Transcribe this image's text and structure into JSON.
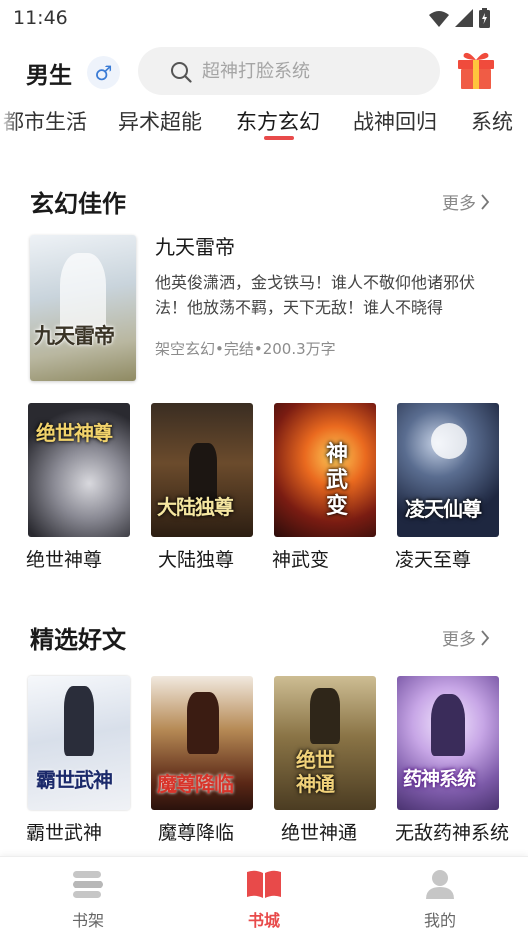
{
  "status_bar": {
    "time": "11:46"
  },
  "header": {
    "gender_label": "男生",
    "gender_symbol": "♂",
    "search_placeholder": "超神打脸系统"
  },
  "tabs": [
    {
      "label": "都市生活"
    },
    {
      "label": "异术超能"
    },
    {
      "label": "东方玄幻",
      "active": true
    },
    {
      "label": "战神回归"
    },
    {
      "label": "系统"
    }
  ],
  "sections": [
    {
      "title": "玄幻佳作",
      "more_label": "更多",
      "featured": {
        "title": "九天雷帝",
        "cover_text": "九天雷帝",
        "description": "他英俊潇洒，金戈铁马！谁人不敬仰他诸邪伏法！他放荡不羁，天下无敌！谁人不晓得",
        "meta": "架空玄幻•完结•200.3万字"
      },
      "books": [
        {
          "title": "绝世神尊",
          "cover_text": "绝世神尊"
        },
        {
          "title": "大陆独尊",
          "cover_text": "大陆独尊"
        },
        {
          "title": "神武变",
          "cover_text": "神武变"
        },
        {
          "title": "凌天至尊",
          "cover_text": "凌天仙尊"
        }
      ]
    },
    {
      "title": "精选好文",
      "more_label": "更多",
      "books": [
        {
          "title": "霸世武神",
          "cover_text": "霸世武神"
        },
        {
          "title": "魔尊降临",
          "cover_text": "魔尊降临"
        },
        {
          "title": "绝世神通",
          "cover_text": "绝世神通"
        },
        {
          "title": "无敌药神系统",
          "cover_text": "药神系统"
        }
      ]
    }
  ],
  "bottom_nav": [
    {
      "label": "书架",
      "icon": "bookshelf-icon"
    },
    {
      "label": "书城",
      "icon": "book-open-icon",
      "active": true
    },
    {
      "label": "我的",
      "icon": "user-icon"
    }
  ],
  "colors": {
    "accent": "#e84a4a",
    "gift": "#f04b3c"
  }
}
